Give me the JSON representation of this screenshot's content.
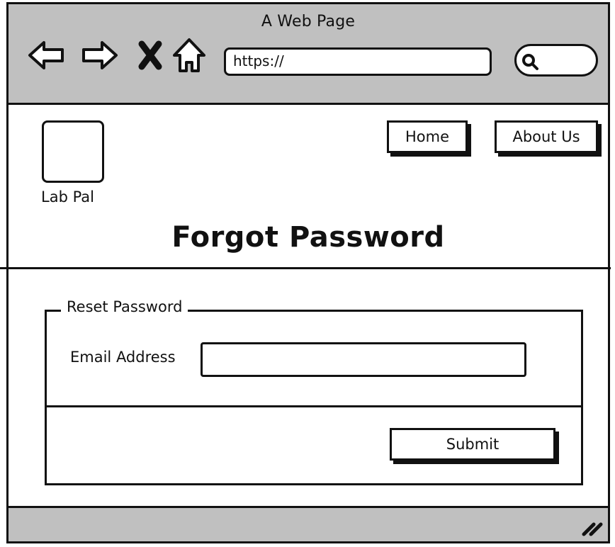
{
  "window": {
    "title": "A Web Page"
  },
  "browser": {
    "url": "https://",
    "search_placeholder": "",
    "icons": [
      "back-arrow-icon",
      "forward-arrow-icon",
      "close-x-icon",
      "home-icon",
      "search-icon",
      "resize-grip-icon"
    ]
  },
  "site": {
    "logo_label": "Lab Pal",
    "nav": {
      "home": "Home",
      "about": "About Us"
    }
  },
  "page": {
    "title": "Forgot Password"
  },
  "form": {
    "legend": "Reset Password",
    "email_label": "Email Address",
    "email_value": "",
    "submit": "Submit"
  },
  "colors": {
    "chrome": "#c0c0c0",
    "ink": "#111111",
    "background": "#ffffff"
  }
}
